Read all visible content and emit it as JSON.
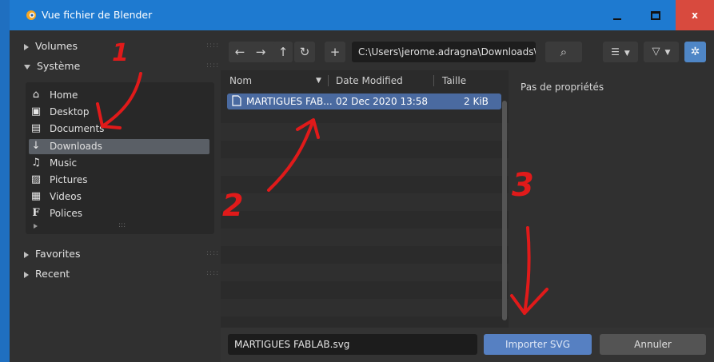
{
  "window": {
    "title": "Vue fichier de Blender",
    "close_label": "x"
  },
  "sidebar": {
    "sections": {
      "volumes": "Volumes",
      "systeme": "Système",
      "favorites": "Favorites",
      "recent": "Recent"
    },
    "places": [
      {
        "label": "Home",
        "icon": "home-icon",
        "glyph": "⌂"
      },
      {
        "label": "Desktop",
        "icon": "desktop-icon",
        "glyph": "▣"
      },
      {
        "label": "Documents",
        "icon": "documents-icon",
        "glyph": "▤"
      },
      {
        "label": "Downloads",
        "icon": "download-icon",
        "glyph": "↓"
      },
      {
        "label": "Music",
        "icon": "music-icon",
        "glyph": "♫"
      },
      {
        "label": "Pictures",
        "icon": "pictures-icon",
        "glyph": "▨"
      },
      {
        "label": "Videos",
        "icon": "videos-icon",
        "glyph": "▦"
      },
      {
        "label": "Polices",
        "icon": "font-icon",
        "glyph": "F"
      }
    ],
    "selected_place": "Downloads"
  },
  "toolbar": {
    "back_glyph": "←",
    "forward_glyph": "→",
    "parent_glyph": "↑",
    "refresh_glyph": "↻",
    "new_folder_glyph": "+",
    "path": "C:\\Users\\jerome.adragna\\Downloads\\",
    "search_glyph": "⌕",
    "view_glyph": "☰",
    "filter_glyph": "▽",
    "settings_glyph": "✲"
  },
  "file_list": {
    "columns": [
      "Nom",
      "Date Modified",
      "Taille"
    ],
    "files": [
      {
        "name": "MARTIGUES FAB...",
        "date": "02 Dec 2020 13:58",
        "size": "2 KiB"
      }
    ]
  },
  "properties": {
    "empty_text": "Pas de propriétés"
  },
  "footer": {
    "filename_value": "MARTIGUES FABLAB.svg",
    "import_label": "Importer SVG",
    "cancel_label": "Annuler"
  },
  "annotations": {
    "labels": [
      "1",
      "2",
      "3"
    ],
    "color": "#e01a1a"
  },
  "colors": {
    "titlebar": "#1e7ad0",
    "selection": "#4a6aa0",
    "import_button": "#5680c2",
    "close_button": "#d84a3e"
  }
}
